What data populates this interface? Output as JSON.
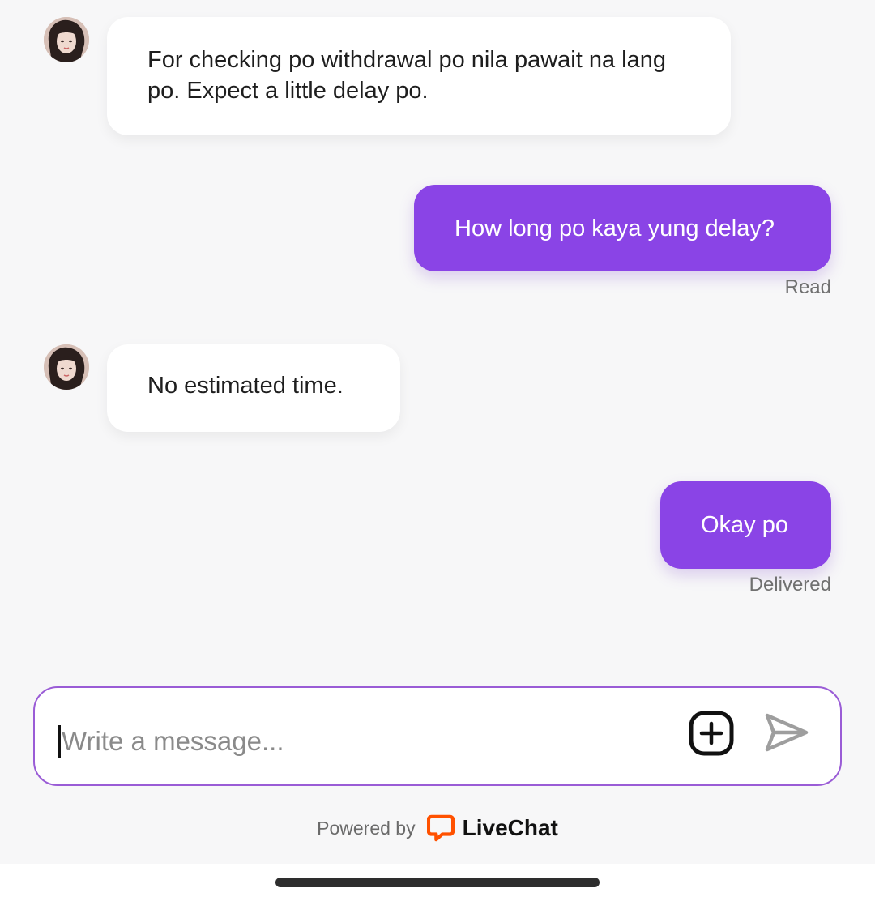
{
  "messages": [
    {
      "author": "agent",
      "text": "For checking po withdrawal po nila pawait na lang po. Expect a little delay po."
    },
    {
      "author": "visitor",
      "text": "How long po kaya yung delay?",
      "status": "Read"
    },
    {
      "author": "agent",
      "text": "No estimated time."
    },
    {
      "author": "visitor",
      "text": "Okay po",
      "status": "Delivered"
    }
  ],
  "composer": {
    "placeholder": "Write a message...",
    "value": "",
    "attach_icon": "add-attachment-icon",
    "send_icon": "send-icon"
  },
  "footer": {
    "powered_by": "Powered by",
    "brand": "LiveChat",
    "brand_icon": "livechat-logo-icon",
    "brand_color": "#ff5100"
  },
  "colors": {
    "visitor_bubble": "#8a44e6",
    "agent_bubble": "#ffffff",
    "background": "#f7f7f8",
    "composer_border": "#9a5cd6"
  }
}
